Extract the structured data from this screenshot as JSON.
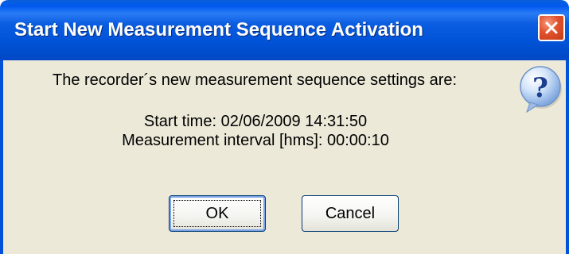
{
  "dialog": {
    "title": "Start New Measurement Sequence Activation",
    "message": "The recorder´s new measurement sequence settings are:",
    "start_time": "Start time: 02/06/2009 14:31:50",
    "interval": "Measurement interval [hms]: 00:00:10",
    "icon": "question-icon",
    "buttons": {
      "ok_label": "OK",
      "cancel_label": "Cancel"
    }
  },
  "colors": {
    "titlebar": "#0052d6",
    "body": "#ece9d8",
    "close": "#e0522e"
  }
}
